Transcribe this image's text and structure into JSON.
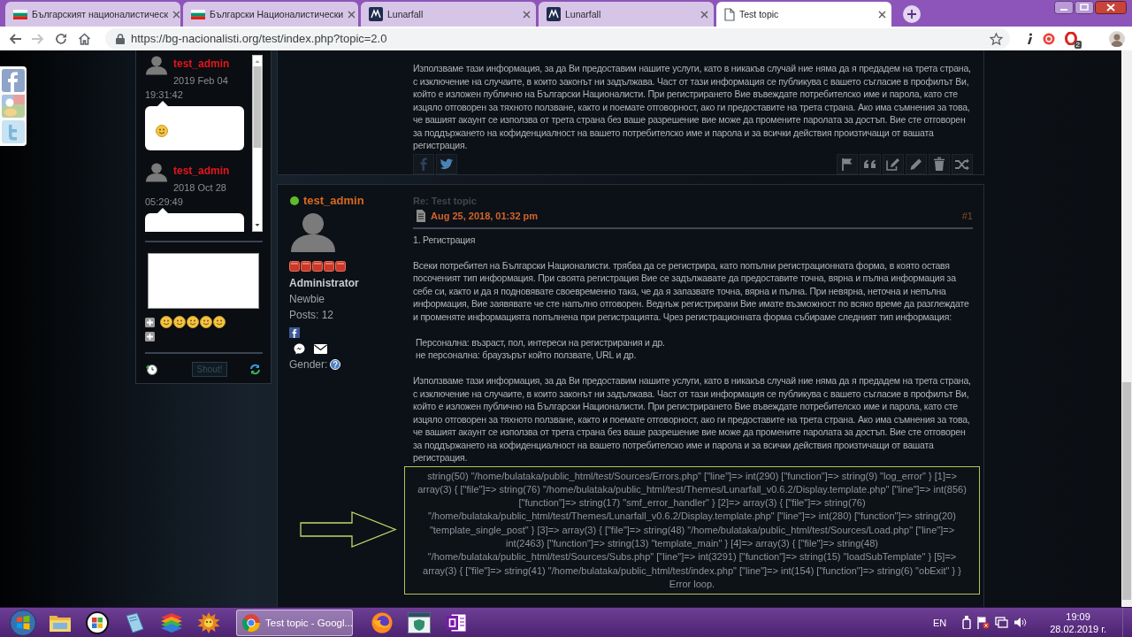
{
  "browser": {
    "tabs": [
      {
        "kind": "flag",
        "title": "Българският националистическ",
        "selected": false
      },
      {
        "kind": "flag",
        "title": "Български Националистически",
        "selected": false
      },
      {
        "kind": "emblem",
        "title": "Lunarfall",
        "selected": false
      },
      {
        "kind": "emblem",
        "title": "Lunarfall",
        "selected": false
      },
      {
        "kind": "page",
        "title": "Test topic",
        "selected": true
      }
    ],
    "forward_disabled": true,
    "address": "https://bg-nacionalisti.org/test/index.php?topic=2.0",
    "extension_badge": "2"
  },
  "shoutbox": {
    "shouts": [
      {
        "author": "test_admin",
        "date": "2019 Feb 04",
        "time": "19:31:42",
        "smiley": true
      },
      {
        "author": "test_admin",
        "date": "2018 Oct 28",
        "time": "05:29:49"
      }
    ],
    "button": "Shout!"
  },
  "previous_post": {
    "body": "Използваме тази информация, за да Ви предоставим нашите услуги, като в никакъв случай ние няма да я предадем на трета страна, с изключение на случаите, в които законът ни задължава. Част от тази информация се публикува с вашето съгласие в профилът Ви, който е изложен публично на Български Националисти. При регистрирането Вие въвеждате потребителско име и парола, като сте изцяло отговорен за тяхното ползване, както и поемате отговорност, ако ги предоставите на трета страна. Ако има съмнения за това, че вашият акаунт се използва от трета страна без ваше разрешение вие може да промените паролата за достъп. Вие сте отговорен за поддържането на кофиденциалност на вашето потребителско име и парола и за всички действия произтичащи от вашата регистрация."
  },
  "post": {
    "author": "test_admin",
    "online": true,
    "stars": 5,
    "group": "Administrator",
    "rank": "Newbie",
    "posts": "Posts: 12",
    "gender_label": "Gender:",
    "subject": "Re: Test topic",
    "date": "Aug 25, 2018, 01:32 pm",
    "number": "#1",
    "body": [
      {
        "kind": "paragraph",
        "text": "1. Регистрация"
      },
      {
        "kind": "paragraph",
        "text": "Всеки потребител на Български Националисти. трябва да се регистрира, като попълни регистрационната форма, в която оставя посоченият тип информация. При своята регистрация Вие се задължавате да предоставите точна, вярна и пълна информация за себе си, както и да я подновявате своевременно така, че да я запазвате точна, вярна и пълна. При невярна, неточна и непълна информация, Вие заявявате че сте напълно отговорен. Веднъж регистрирани Вие имате възможност по всяко време да разглеждате и променяте информацията попълнена при регистрацията. Чрез регистрационната форма събираме следният тип информация:"
      },
      {
        "kind": "lines",
        "lines": [
          "Персонална: възраст, пол, интереси на регистрирания и др.",
          "не персонална: браузърът който ползвате, URL и др."
        ]
      },
      {
        "kind": "paragraph",
        "text": "Използваме тази информация, за да Ви предоставим нашите услуги, като в никакъв случай ние няма да я предадем на трета страна, с изключение на случаите, в които законът ни задължава. Част от тази информация се публикува с вашето съгласие в профилът Ви, който е изложен публично на Български Националисти. При регистрирането Вие въвеждате потребителско име и парола, като сте изцяло отговорен за тяхното ползване, както и поемате отговорност, ако ги предоставите на трета страна. Ако има съмнения за това, че вашият акаунт се използва от трета страна без ваше разрешение вие може да промените паролата за достъп. Вие сте отговорен за поддържането на кофиденциалност на вашето потребителско име и парола и за всички действия произтичащи от вашата регистрация."
      }
    ],
    "error": {
      "dump": "string(50) \"/home/bulataka/public_html/test/Sources/Errors.php\" [\"line\"]=> int(290) [\"function\"]=> string(9) \"log_error\" } [1]=> array(3) { [\"file\"]=> string(76) \"/home/bulataka/public_html/test/Themes/Lunarfall_v0.6.2/Display.template.php\" [\"line\"]=> int(856) [\"function\"]=> string(17) \"smf_error_handler\" } [2]=> array(3) { [\"file\"]=> string(76) \"/home/bulataka/public_html/test/Themes/Lunarfall_v0.6.2/Display.template.php\" [\"line\"]=> int(280) [\"function\"]=> string(20) \"template_single_post\" } [3]=> array(3) { [\"file\"]=> string(48) \"/home/bulataka/public_html/test/Sources/Load.php\" [\"line\"]=> int(2463) [\"function\"]=> string(13) \"template_main\" } [4]=> array(3) { [\"file\"]=> string(48) \"/home/bulataka/public_html/test/Sources/Subs.php\" [\"line\"]=> int(3291) [\"function\"]=> string(15) \"loadSubTemplate\" } [5]=> array(3) { [\"file\"]=> string(41) \"/home/bulataka/public_html/test/index.php\" [\"line\"]=> int(154) [\"function\"]=> string(6) \"obExit\" } }",
      "message": "Error loop."
    }
  },
  "taskbar": {
    "window_button": {
      "label": "Test topic - Googl...",
      "selected": true
    },
    "language": "EN",
    "time": "19:09",
    "date": "28.02.2019 г."
  }
}
